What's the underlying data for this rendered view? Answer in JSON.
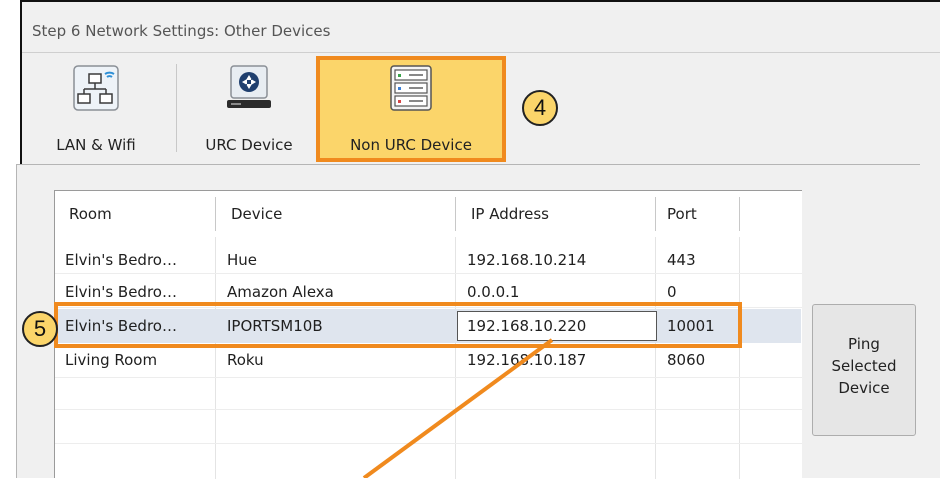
{
  "window": {
    "title": "Step 6 Network Settings: Other Devices"
  },
  "toolbar": {
    "buttons": [
      {
        "label": "LAN & Wifi",
        "icon": "network-wifi-icon"
      },
      {
        "label": "URC Device",
        "icon": "urc-device-icon"
      },
      {
        "label": "Non URC Device",
        "icon": "server-rack-icon",
        "selected": true
      }
    ]
  },
  "callouts": {
    "toolbar": "4",
    "row": "5"
  },
  "table": {
    "columns": [
      "Room",
      "Device",
      "IP Address",
      "Port"
    ],
    "rows": [
      {
        "room": "Elvin's Bedro…",
        "device": "Hue",
        "ip": "192.168.10.214",
        "port": "443"
      },
      {
        "room": "Elvin's Bedro…",
        "device": "Amazon Alexa",
        "ip": "0.0.0.1",
        "port": "0"
      },
      {
        "room": "Elvin's Bedro…",
        "device": "IPORTSM10B",
        "ip": "192.168.10.220",
        "port": "10001",
        "selected": true
      },
      {
        "room": "Living Room",
        "device": "Roku",
        "ip": "192.168.10.187",
        "port": "8060"
      }
    ]
  },
  "ping_button": {
    "line1": "Ping",
    "line2": "Selected",
    "line3": "Device"
  },
  "colors": {
    "highlight_orange": "#f08a1e",
    "selected_fill": "#fbd56a"
  }
}
